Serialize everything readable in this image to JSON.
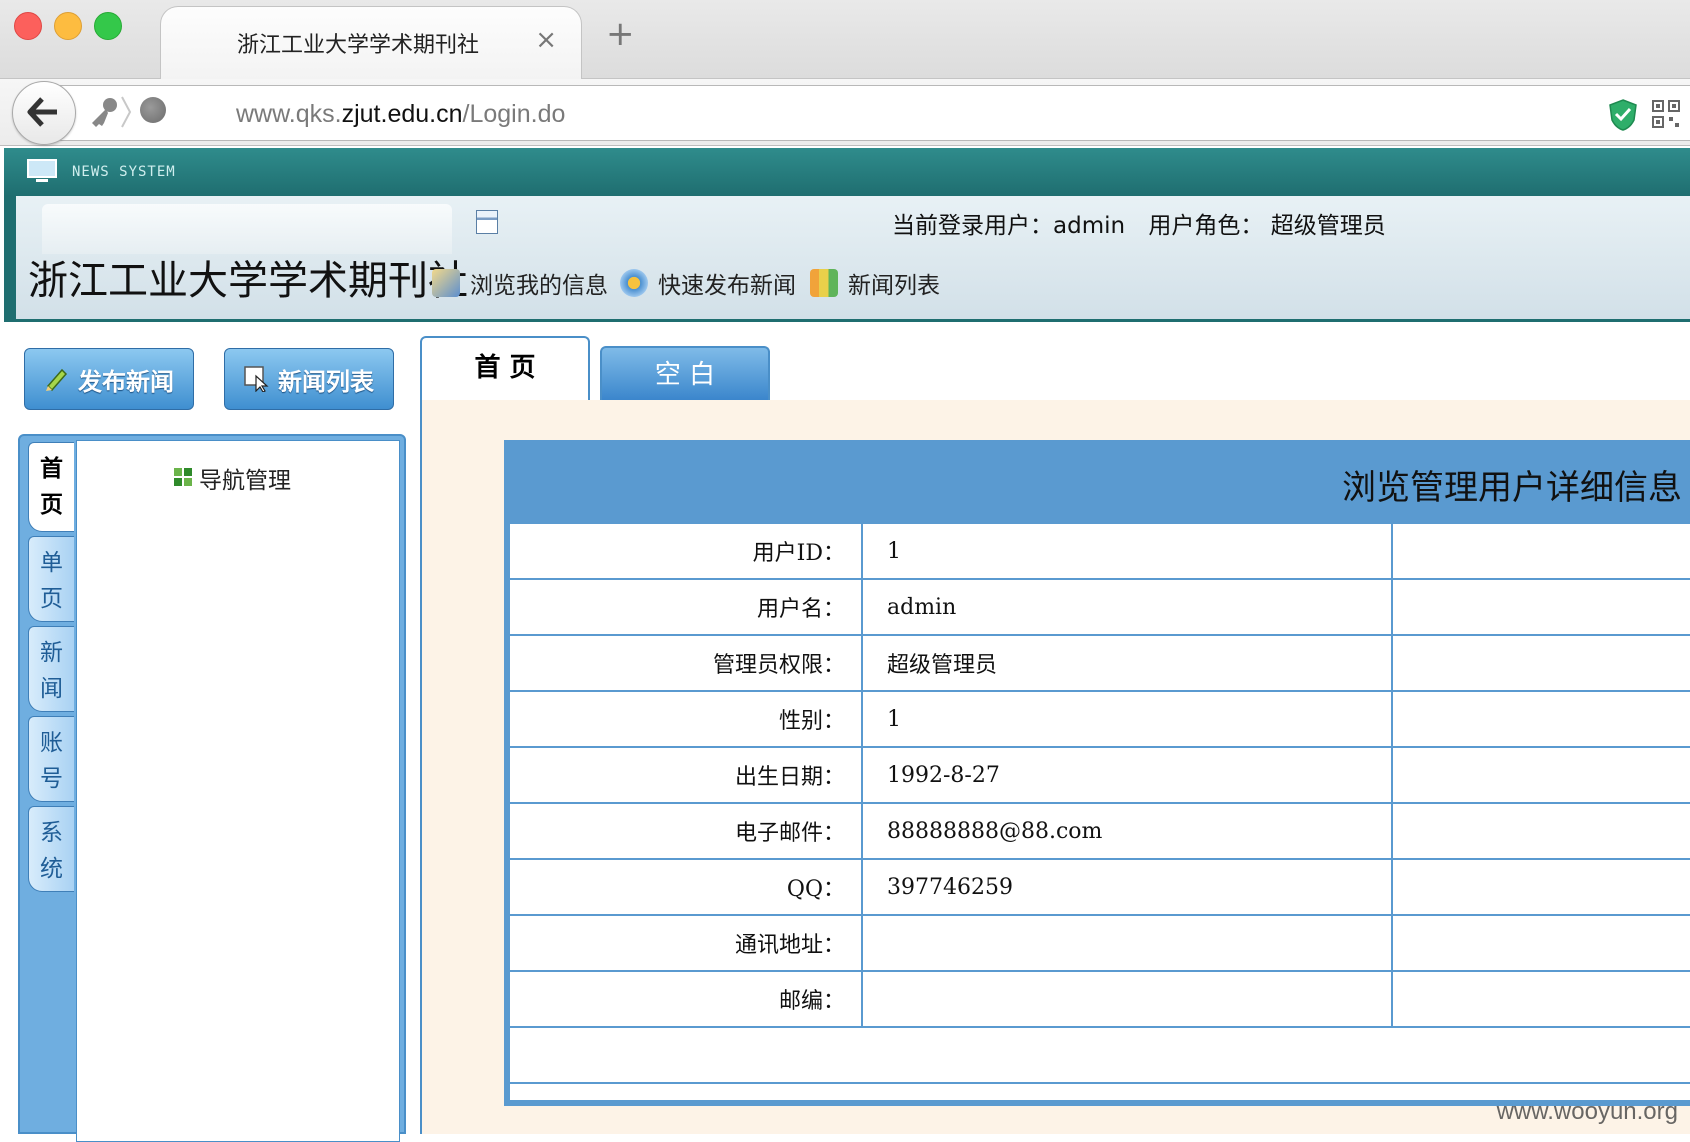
{
  "browser": {
    "tab_title": "浙江工业大学学术期刊社",
    "tab_close": "×",
    "new_tab": "+",
    "url_prefix": "www.qks.",
    "url_domain": "zjut.edu.cn",
    "url_path": "/Login.do"
  },
  "app": {
    "system_label": "NEWS SYSTEM",
    "brand": "浙江工业大学学术期刊社",
    "current_user_label": "当前登录用户：admin",
    "role_label": "用户角色：  超级管理员",
    "quick_links": [
      "浏览我的信息",
      "快速发布新闻",
      "新闻列表"
    ]
  },
  "sidebar": {
    "buttons": [
      "发布新闻",
      "新闻列表"
    ],
    "vtabs": [
      "首页",
      "单页",
      "新闻",
      "账号",
      "系统"
    ],
    "tree_item": "导航管理"
  },
  "main": {
    "tabs": [
      "首 页",
      "空 白"
    ],
    "card_title": "浏览管理用户详细信息",
    "rows": [
      {
        "label": "用户ID：",
        "value": "1"
      },
      {
        "label": "用户名：",
        "value": "admin"
      },
      {
        "label": "管理员权限：",
        "value": "超级管理员"
      },
      {
        "label": "性别：",
        "value": "1"
      },
      {
        "label": "出生日期：",
        "value": "1992-8-27"
      },
      {
        "label": "电子邮件：",
        "value": "88888888@88.com"
      },
      {
        "label": "QQ：",
        "value": "397746259"
      },
      {
        "label": "通讯地址：",
        "value": ""
      },
      {
        "label": "邮编：",
        "value": ""
      }
    ]
  },
  "watermark": "www.wooyun.org",
  "colors": {
    "header_teal": "#1f6e70",
    "panel_blue": "#5a9ad0",
    "content_bg": "#fdf3e7"
  }
}
